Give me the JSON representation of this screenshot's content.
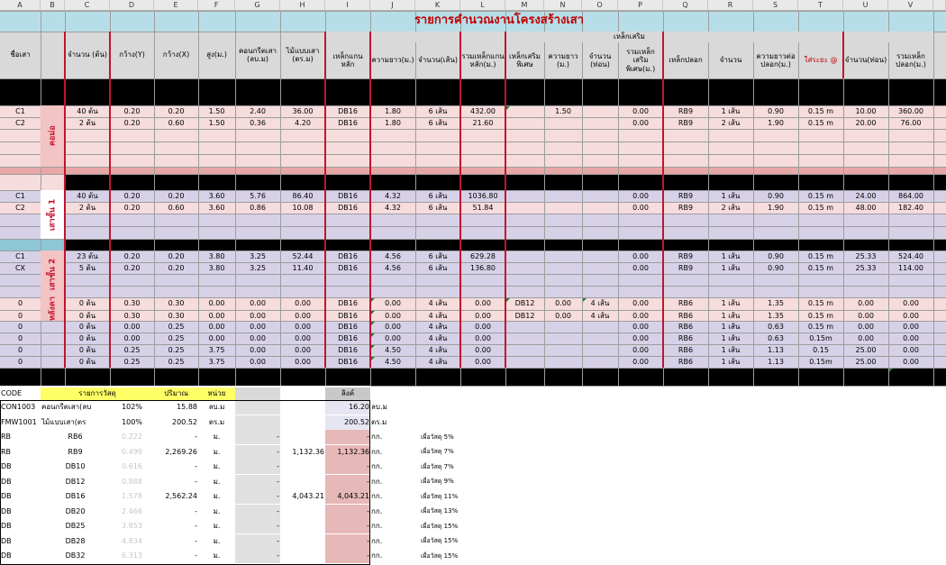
{
  "title": "รายการคำนวณงานโครงสร้างเสา",
  "columns": [
    "A",
    "B",
    "C",
    "D",
    "E",
    "F",
    "G",
    "H",
    "I",
    "J",
    "K",
    "L",
    "M",
    "N",
    "O",
    "P",
    "Q",
    "R",
    "S",
    "T",
    "U",
    "V"
  ],
  "headers": {
    "group_rebar": "เหล็กเสริม",
    "A": "ชื่อเสา",
    "C": "จำนวน (ต้น)",
    "D": "กว้าง(Y)",
    "E": "กว้าง(X)",
    "F": "สูง(ม.)",
    "G": "คอนกรีตเสา (ลบ.ม)",
    "H": "ไม้แบบเสา (ตร.ม)",
    "I": "เหล็กแกนหลัก",
    "J": "ความยาว(ม.)",
    "K": "จำนวน(เส้น)",
    "L": "รวมเหล็กแกนหลัก(ม.)",
    "M": "เหล็กเสริมพิเศษ",
    "N": "ความยาว (ม.)",
    "O": "จำนวน (ท่อน)",
    "P": "รวมเหล็กเสริมพิเศษ(ม.)",
    "Q": "เหล็กปลอก",
    "R": "จำนวน",
    "S": "ความยาวต่อปลอก(ม.)",
    "T": "ใส่ระยะ @",
    "U": "จำนวน(ท่อน)",
    "V": "รวมเหล็กปลอก(ม.)"
  },
  "sections": [
    "คอม่อ",
    "เสาชั้น 1",
    "เสาชั้น 2",
    "หลังคา"
  ],
  "rows": [
    [
      "C1",
      "40 ต้น",
      "0.20",
      "0.20",
      "1.50",
      "2.40",
      "36.00",
      "DB16",
      "1.80",
      "6 เส้น",
      "432.00",
      "",
      "1.50",
      "",
      "0.00",
      "RB9",
      "1 เส้น",
      "0.90",
      "0.15 m",
      "10.00",
      "360.00"
    ],
    [
      "C2",
      "2 ต้น",
      "0.20",
      "0.60",
      "1.50",
      "0.36",
      "4.20",
      "DB16",
      "1.80",
      "6 เส้น",
      "21.60",
      "",
      "",
      "",
      "0.00",
      "RB9",
      "2 เส้น",
      "1.90",
      "0.15 m",
      "20.00",
      "76.00"
    ],
    [
      "C1",
      "40 ต้น",
      "0.20",
      "0.20",
      "3.60",
      "5.76",
      "86.40",
      "DB16",
      "4.32",
      "6 เส้น",
      "1036.80",
      "",
      "",
      "",
      "0.00",
      "RB9",
      "1 เส้น",
      "0.90",
      "0.15 m",
      "24.00",
      "864.00"
    ],
    [
      "C2",
      "2 ต้น",
      "0.20",
      "0.60",
      "3.60",
      "0.86",
      "10.08",
      "DB16",
      "4.32",
      "6 เส้น",
      "51.84",
      "",
      "",
      "",
      "0.00",
      "RB9",
      "2 เส้น",
      "1.90",
      "0.15 m",
      "48.00",
      "182.40"
    ],
    [
      "C1",
      "23 ต้น",
      "0.20",
      "0.20",
      "3.80",
      "3.25",
      "52.44",
      "DB16",
      "4.56",
      "6 เส้น",
      "629.28",
      "",
      "",
      "",
      "0.00",
      "RB9",
      "1 เส้น",
      "0.90",
      "0.15 m",
      "25.33",
      "524.40"
    ],
    [
      "CX",
      "5 ต้น",
      "0.20",
      "0.20",
      "3.80",
      "3.25",
      "11.40",
      "DB16",
      "4.56",
      "6 เส้น",
      "136.80",
      "",
      "",
      "",
      "0.00",
      "RB9",
      "1 เส้น",
      "0.90",
      "0.15 m",
      "25.33",
      "114.00"
    ],
    [
      "0",
      "0 ต้น",
      "0.30",
      "0.30",
      "0.00",
      "0.00",
      "0.00",
      "DB16",
      "0.00",
      "4 เส้น",
      "0.00",
      "DB12",
      "0.00",
      "4 เส้น",
      "0.00",
      "RB6",
      "1 เส้น",
      "1.35",
      "0.15 m",
      "0.00",
      "0.00"
    ],
    [
      "0",
      "0 ต้น",
      "0.30",
      "0.30",
      "0.00",
      "0.00",
      "0.00",
      "DB16",
      "0.00",
      "4 เส้น",
      "0.00",
      "DB12",
      "0.00",
      "4 เส้น",
      "0.00",
      "RB6",
      "1 เส้น",
      "1.35",
      "0.15 m",
      "0.00",
      "0.00"
    ],
    [
      "0",
      "0 ต้น",
      "0.00",
      "0.25",
      "0.00",
      "0.00",
      "0.00",
      "DB16",
      "0.00",
      "4 เส้น",
      "0.00",
      "",
      "",
      "",
      "0.00",
      "RB6",
      "1 เส้น",
      "0.63",
      "0.15 m",
      "0.00",
      "0.00"
    ],
    [
      "0",
      "0 ต้น",
      "0.00",
      "0.25",
      "0.00",
      "0.00",
      "0.00",
      "DB16",
      "0.00",
      "4 เส้น",
      "0.00",
      "",
      "",
      "",
      "0.00",
      "RB6",
      "1 เส้น",
      "0.63",
      "0.15m",
      "0.00",
      "0.00"
    ],
    [
      "0",
      "0 ต้น",
      "0.25",
      "0.25",
      "3.75",
      "0.00",
      "0.00",
      "DB16",
      "4.50",
      "4 เส้น",
      "0.00",
      "",
      "",
      "",
      "0.00",
      "RB6",
      "1 เส้น",
      "1.13",
      "0.15",
      "25.00",
      "0.00"
    ],
    [
      "0",
      "0 ต้น",
      "0.25",
      "0.25",
      "3.75",
      "0.00",
      "0.00",
      "DB16",
      "4.50",
      "4 เส้น",
      "0.00",
      "",
      "",
      "",
      "0.00",
      "RB6",
      "1 เส้น",
      "1.13",
      "0.15m",
      "25.00",
      "0.00"
    ]
  ],
  "summary_headers": {
    "code": "CODE",
    "item": "รายการวัสดุ",
    "qty": "ปริมาณ",
    "unit": "หน่วย",
    "total": "ลิงค์"
  },
  "summary": [
    {
      "code": "CON1003",
      "b": "คอนกรีตเสา(ลบ",
      "pct": "102%",
      "qty": "15.88",
      "unit": "ลบ.ม",
      "g": "",
      "h": "",
      "link": "16.20",
      "lunit": "ลบ.ม",
      "note": ""
    },
    {
      "code": "FMW1001",
      "b": "ไม้แบบเสา(ตร",
      "pct": "100%",
      "qty": "200.52",
      "unit": "ตร.ม",
      "g": "",
      "h": "",
      "link": "200.52",
      "lunit": "ตร.ม",
      "note": ""
    },
    {
      "code": "RB",
      "b": "RB6",
      "pct": "0.222",
      "qty": "-",
      "unit": "ม.",
      "g": "-",
      "h": "",
      "link": "-",
      "lunit": "กก.",
      "note": "เผื่อวัสดุ 5%"
    },
    {
      "code": "RB",
      "b": "RB9",
      "pct": "0.499",
      "qty": "2,269.26",
      "unit": "ม.",
      "g": "-",
      "h": "1,132.36",
      "link": "1,132.36",
      "lunit": "กก.",
      "note": "เผื่อวัสดุ 7%"
    },
    {
      "code": "DB",
      "b": "DB10",
      "pct": "0.616",
      "qty": "-",
      "unit": "ม.",
      "g": "-",
      "h": "",
      "link": "-",
      "lunit": "กก.",
      "note": "เผื่อวัสดุ 7%"
    },
    {
      "code": "DB",
      "b": "DB12",
      "pct": "0.888",
      "qty": "-",
      "unit": "ม.",
      "g": "-",
      "h": "",
      "link": "-",
      "lunit": "กก.",
      "note": "เผื่อวัสดุ 9%"
    },
    {
      "code": "DB",
      "b": "DB16",
      "pct": "1.578",
      "qty": "2,562.24",
      "unit": "ม.",
      "g": "-",
      "h": "4,043.21",
      "link": "4,043.21",
      "lunit": "กก.",
      "note": "เผื่อวัสดุ 11%"
    },
    {
      "code": "DB",
      "b": "DB20",
      "pct": "2.466",
      "qty": "-",
      "unit": "ม.",
      "g": "-",
      "h": "",
      "link": "-",
      "lunit": "กก.",
      "note": "เผื่อวัสดุ 13%"
    },
    {
      "code": "DB",
      "b": "DB25",
      "pct": "3.853",
      "qty": "-",
      "unit": "ม.",
      "g": "-",
      "h": "",
      "link": "-",
      "lunit": "กก.",
      "note": "เผื่อวัสดุ 15%"
    },
    {
      "code": "DB",
      "b": "DB28",
      "pct": "4.834",
      "qty": "-",
      "unit": "ม.",
      "g": "-",
      "h": "",
      "link": "-",
      "lunit": "กก.",
      "note": "เผื่อวัสดุ 15%"
    },
    {
      "code": "DB",
      "b": "DB32",
      "pct": "6.313",
      "qty": "-",
      "unit": "ม.",
      "g": "-",
      "h": "",
      "link": "-",
      "lunit": "กก.",
      "note": "เผื่อวัสดุ 15%"
    }
  ],
  "colors": {
    "title_bg": "#b7dee8",
    "title_text": "#c00000",
    "pink_row": "#f6dcdc",
    "purple_row": "#d7d1e8",
    "accent_red": "#c0152e",
    "link_bg": "#e6b8b7"
  }
}
